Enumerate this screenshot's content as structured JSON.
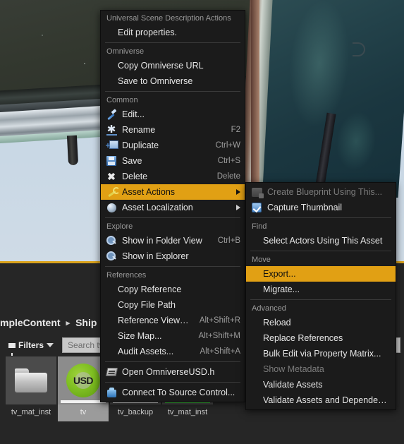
{
  "viewport": {
    "name": "level-viewport",
    "description": "3D viewport showing weathered retro TV models against pale blue background"
  },
  "content_browser": {
    "breadcrumb": [
      "mpleContent",
      "Ship"
    ],
    "breadcrumb_separator": "▸",
    "filters_label": "Filters",
    "search_placeholder": "Search tv",
    "assets": [
      {
        "label": "tv_mat_inst",
        "thumb": "folder",
        "selected": false
      },
      {
        "label": "tv",
        "thumb": "usd",
        "selected": true,
        "usd_text": "USD"
      },
      {
        "label": "tv_backup",
        "thumb": "tv",
        "selected": false
      },
      {
        "label": "tv_mat_inst",
        "thumb": "tv-green",
        "selected": false
      }
    ]
  },
  "context_menu": {
    "sections": [
      {
        "header": "Universal Scene Description Actions",
        "items": [
          {
            "label": "Edit properties.",
            "icon": "none",
            "accel": "",
            "indent": true
          }
        ]
      },
      {
        "header": "Omniverse",
        "items": [
          {
            "label": "Copy Omniverse URL",
            "icon": "none",
            "accel": "",
            "indent": true
          },
          {
            "label": "Save to Omniverse",
            "icon": "none",
            "accel": "",
            "indent": true
          }
        ]
      },
      {
        "header": "Common",
        "items": [
          {
            "label": "Edit...",
            "icon": "edit-icon",
            "accel": ""
          },
          {
            "label": "Rename",
            "icon": "rename-icon",
            "accel": "F2"
          },
          {
            "label": "Duplicate",
            "icon": "duplicate-icon",
            "accel": "Ctrl+W"
          },
          {
            "label": "Save",
            "icon": "save-icon",
            "accel": "Ctrl+S"
          },
          {
            "label": "Delete",
            "icon": "delete-icon",
            "accel": "Delete"
          },
          {
            "label": "Asset Actions",
            "icon": "wrench-icon",
            "accel": "",
            "submenu": true,
            "highlighted": true
          },
          {
            "label": "Asset Localization",
            "icon": "sphere-icon",
            "accel": "",
            "submenu": true
          }
        ]
      },
      {
        "header": "Explore",
        "items": [
          {
            "label": "Show in Folder View",
            "icon": "magnifier-icon",
            "accel": "Ctrl+B"
          },
          {
            "label": "Show in Explorer",
            "icon": "magnifier-icon",
            "accel": ""
          }
        ]
      },
      {
        "header": "References",
        "items": [
          {
            "label": "Copy Reference",
            "icon": "none",
            "accel": "",
            "indent": true
          },
          {
            "label": "Copy File Path",
            "icon": "none",
            "accel": "",
            "indent": true
          },
          {
            "label": "Reference Viewer...",
            "icon": "none",
            "accel": "Alt+Shift+R",
            "indent": true
          },
          {
            "label": "Size Map...",
            "icon": "none",
            "accel": "Alt+Shift+M",
            "indent": true
          },
          {
            "label": "Audit Assets...",
            "icon": "none",
            "accel": "Alt+Shift+A",
            "indent": true
          }
        ]
      },
      {
        "header": "",
        "items": [
          {
            "label": "Open OmniverseUSD.h",
            "icon": "header-file-icon",
            "accel": ""
          },
          {
            "label": "Connect To Source Control...",
            "icon": "source-control-icon",
            "accel": ""
          }
        ]
      }
    ]
  },
  "asset_actions_submenu": {
    "sections": [
      {
        "header": "",
        "items": [
          {
            "label": "Create Blueprint Using This...",
            "icon": "blueprint-icon",
            "accel": "",
            "disabled": true
          },
          {
            "label": "Capture Thumbnail",
            "icon": "checkbox-icon",
            "accel": ""
          }
        ]
      },
      {
        "header": "Find",
        "items": [
          {
            "label": "Select Actors Using This Asset",
            "icon": "none",
            "accel": "",
            "indent": true
          }
        ]
      },
      {
        "header": "Move",
        "items": [
          {
            "label": "Export...",
            "icon": "none",
            "accel": "",
            "indent": true,
            "highlighted": true
          },
          {
            "label": "Migrate...",
            "icon": "none",
            "accel": "",
            "indent": true
          }
        ]
      },
      {
        "header": "Advanced",
        "items": [
          {
            "label": "Reload",
            "icon": "none",
            "accel": "",
            "indent": true
          },
          {
            "label": "Replace References",
            "icon": "none",
            "accel": "",
            "indent": true
          },
          {
            "label": "Bulk Edit via Property Matrix...",
            "icon": "none",
            "accel": "",
            "indent": true
          },
          {
            "label": "Show Metadata",
            "icon": "none",
            "accel": "",
            "indent": true,
            "disabled": true
          },
          {
            "label": "Validate Assets",
            "icon": "none",
            "accel": "",
            "indent": true
          },
          {
            "label": "Validate Assets and Dependencies",
            "icon": "none",
            "accel": "",
            "indent": true
          }
        ]
      }
    ]
  },
  "colors": {
    "highlight": "#e1a014",
    "menu_bg": "#1b1b1b",
    "section_header": "#9a9a9a",
    "viewport_border": "#d9a21b",
    "panel_bg": "#262626"
  }
}
